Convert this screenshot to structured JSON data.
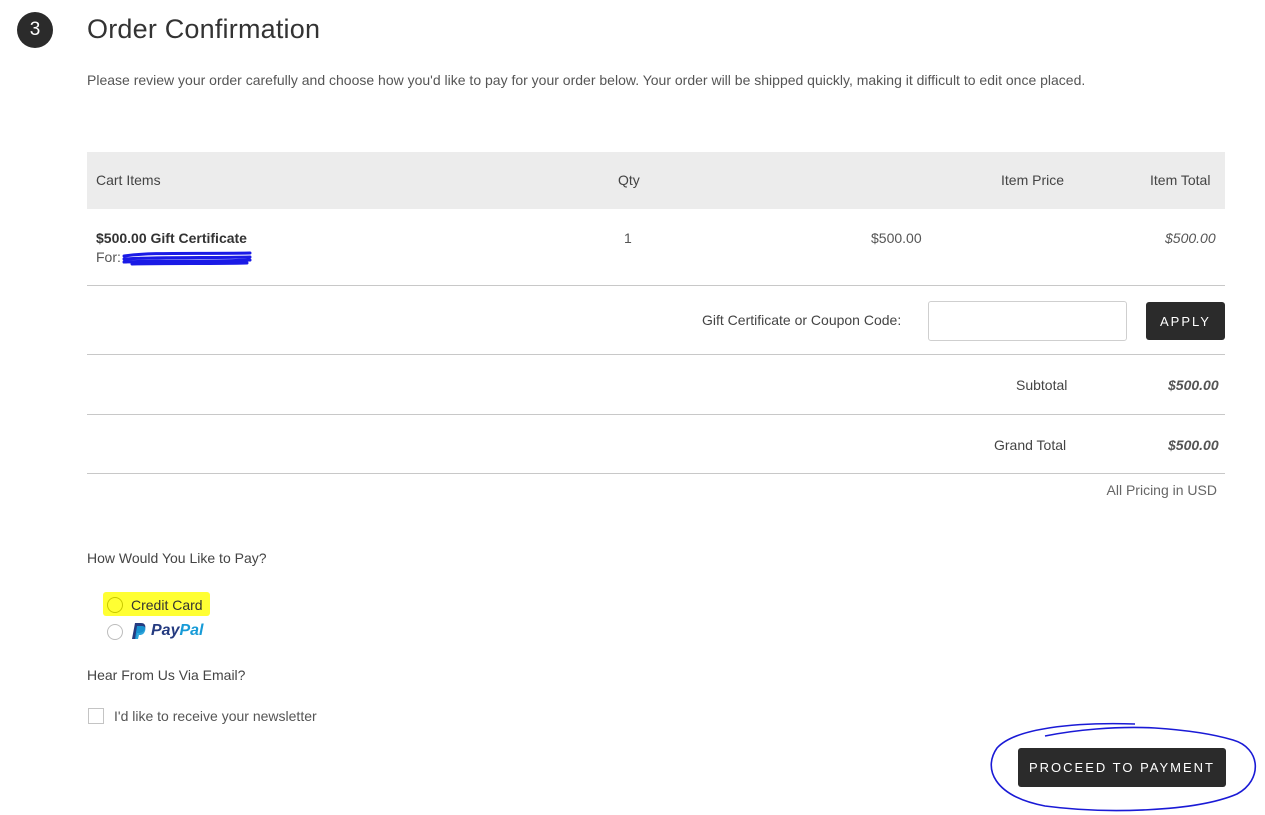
{
  "step": {
    "number": "3",
    "title": "Order Confirmation"
  },
  "intro_text": "Please review your order carefully and choose how you'd like to pay for your order below. Your order will be shipped quickly, making it difficult to edit once placed.",
  "cart": {
    "headers": {
      "items": "Cart Items",
      "qty": "Qty",
      "price": "Item Price",
      "total": "Item Total"
    },
    "rows": [
      {
        "name": "$500.00 Gift Certificate",
        "for_label": "For:",
        "qty": "1",
        "price": "$500.00",
        "total": "$500.00"
      }
    ]
  },
  "coupon": {
    "label": "Gift Certificate or Coupon Code:",
    "value": "",
    "placeholder": "",
    "apply_label": "APPLY"
  },
  "summary": {
    "subtotal_label": "Subtotal",
    "subtotal_value": "$500.00",
    "grand_total_label": "Grand Total",
    "grand_total_value": "$500.00",
    "pricing_note": "All Pricing in USD"
  },
  "payment": {
    "question": "How Would You Like to Pay?",
    "options": [
      {
        "label": "Credit Card"
      },
      {
        "label": "PayPal"
      }
    ]
  },
  "email": {
    "question": "Hear From Us Via Email?",
    "newsletter_label": "I'd like to receive your newsletter"
  },
  "proceed_label": "PROCEED TO PAYMENT",
  "colors": {
    "dark": "#2b2b2b",
    "highlight": "#ffff33",
    "annotation": "#1a1ad6",
    "paypal_dark": "#253b80",
    "paypal_light": "#179bd7"
  }
}
